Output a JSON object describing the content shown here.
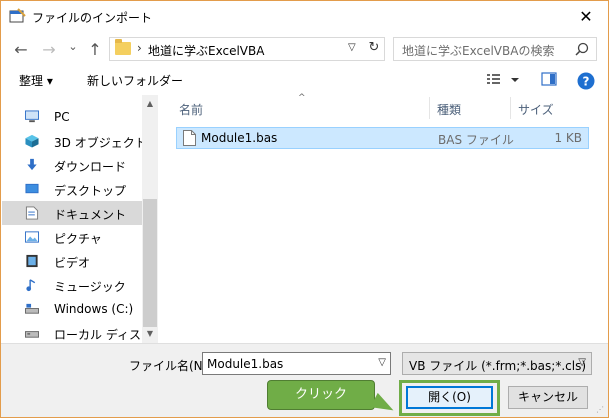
{
  "window": {
    "title": "ファイルのインポート"
  },
  "nav": {
    "back": "←",
    "forward": "→",
    "recent": "⌄",
    "up": "↑",
    "address": "地道に学ぶExcelVBA",
    "search_placeholder": "地道に学ぶExcelVBAの検索"
  },
  "toolbar": {
    "organize": "整理 ▾",
    "new_folder": "新しいフォルダー"
  },
  "sidebar": {
    "items": [
      {
        "label": "PC",
        "icon": "pc-icon"
      },
      {
        "label": "3D オブジェクト",
        "icon": "3d-objects-icon"
      },
      {
        "label": "ダウンロード",
        "icon": "download-icon"
      },
      {
        "label": "デスクトップ",
        "icon": "desktop-icon"
      },
      {
        "label": "ドキュメント",
        "icon": "documents-icon"
      },
      {
        "label": "ピクチャ",
        "icon": "pictures-icon"
      },
      {
        "label": "ビデオ",
        "icon": "video-icon"
      },
      {
        "label": "ミュージック",
        "icon": "music-icon"
      },
      {
        "label": "Windows (C:)",
        "icon": "drive-c-icon"
      },
      {
        "label": "ローカル ディスク (E",
        "icon": "drive-e-icon"
      }
    ],
    "selected_index": 4
  },
  "columns": {
    "name": "名前",
    "type": "種類",
    "size": "サイズ"
  },
  "files": [
    {
      "name": "Module1.bas",
      "type": "BAS ファイル",
      "size": "1 KB"
    }
  ],
  "footer": {
    "filename_label": "ファイル名(N):",
    "filename_value": "Module1.bas",
    "filetype": "VB ファイル (*.frm;*.bas;*.cls)",
    "open_button": "開く(O)",
    "cancel_button": "キャンセル",
    "callout": "クリック"
  },
  "colors": {
    "accent": "#0078d7",
    "selection": "#cce8ff",
    "callout": "#70ad47",
    "window_border": "#e39c4b"
  }
}
